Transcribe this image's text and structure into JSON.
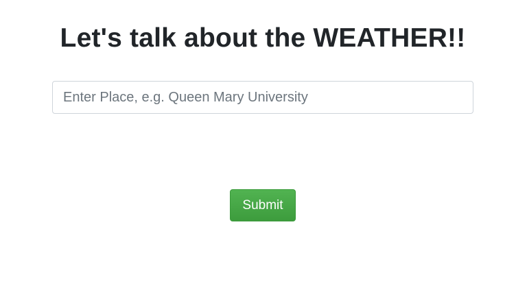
{
  "header": {
    "title": "Let's talk about the WEATHER!!"
  },
  "form": {
    "place_input": {
      "value": "",
      "placeholder": "Enter Place, e.g. Queen Mary University"
    },
    "submit_label": "Submit"
  },
  "colors": {
    "submit_button": "#45a845",
    "title_text": "#212529",
    "input_border": "#ced4da",
    "placeholder_text": "#6c757d"
  }
}
